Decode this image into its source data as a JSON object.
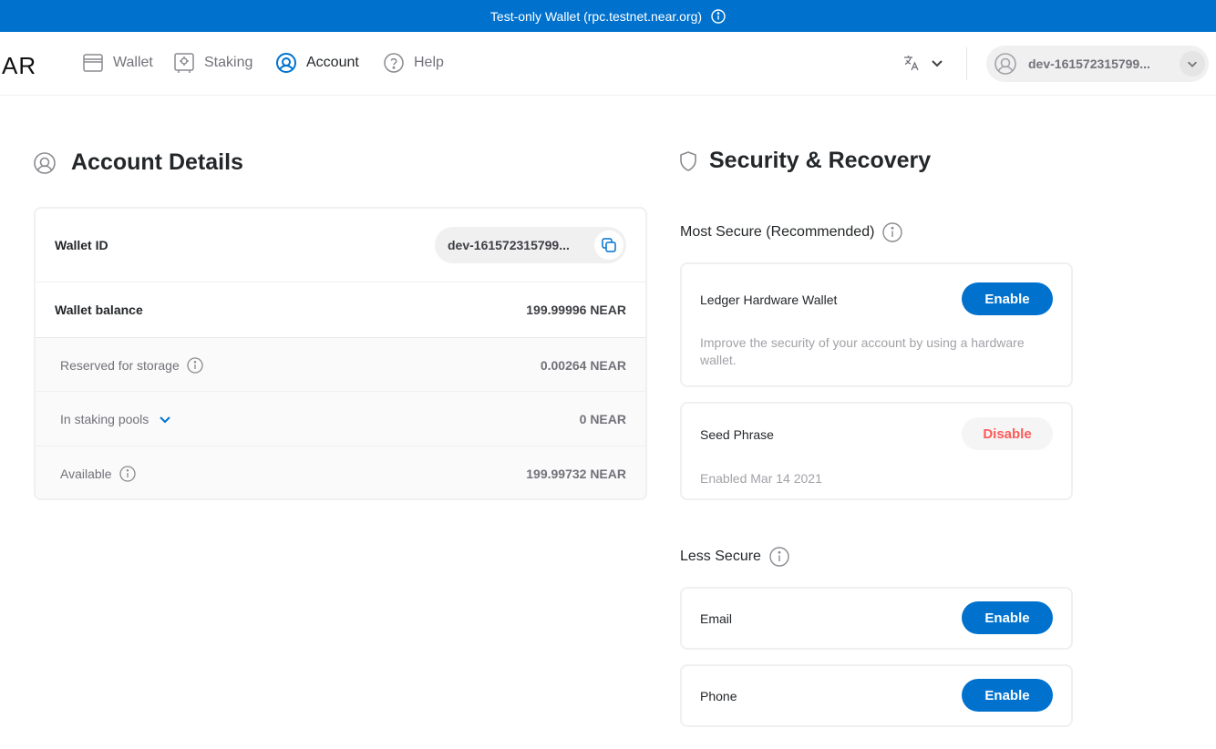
{
  "banner": {
    "text": "Test-only Wallet (rpc.testnet.near.org)"
  },
  "nav": {
    "logo": "AR",
    "items": [
      {
        "label": "Wallet",
        "icon": "wallet-icon"
      },
      {
        "label": "Staking",
        "icon": "staking-icon"
      },
      {
        "label": "Account",
        "icon": "account-icon"
      },
      {
        "label": "Help",
        "icon": "help-icon"
      }
    ],
    "active": "Account",
    "account_name": "dev-161572315799..."
  },
  "account_details": {
    "heading": "Account Details",
    "wallet_id_label": "Wallet ID",
    "wallet_id_value": "dev-161572315799...",
    "wallet_balance_label": "Wallet balance",
    "wallet_balance_value": "199.99996 NEAR",
    "reserved_label": "Reserved for storage",
    "reserved_value": "0.00264 NEAR",
    "staking_label": "In staking pools",
    "staking_value": "0 NEAR",
    "available_label": "Available",
    "available_value": "199.99732 NEAR"
  },
  "security": {
    "heading": "Security & Recovery",
    "most_secure_label": "Most Secure (Recommended)",
    "less_secure_label": "Less Secure",
    "ledger": {
      "title": "Ledger Hardware Wallet",
      "desc": "Improve the security of your account by using a hardware wallet.",
      "button": "Enable"
    },
    "seed": {
      "title": "Seed Phrase",
      "desc": "Enabled Mar 14 2021",
      "button": "Disable"
    },
    "email": {
      "title": "Email",
      "button": "Enable"
    },
    "phone": {
      "title": "Phone",
      "button": "Enable"
    }
  },
  "colors": {
    "brand_blue": "#0072ce",
    "danger": "#fc5b5b"
  }
}
